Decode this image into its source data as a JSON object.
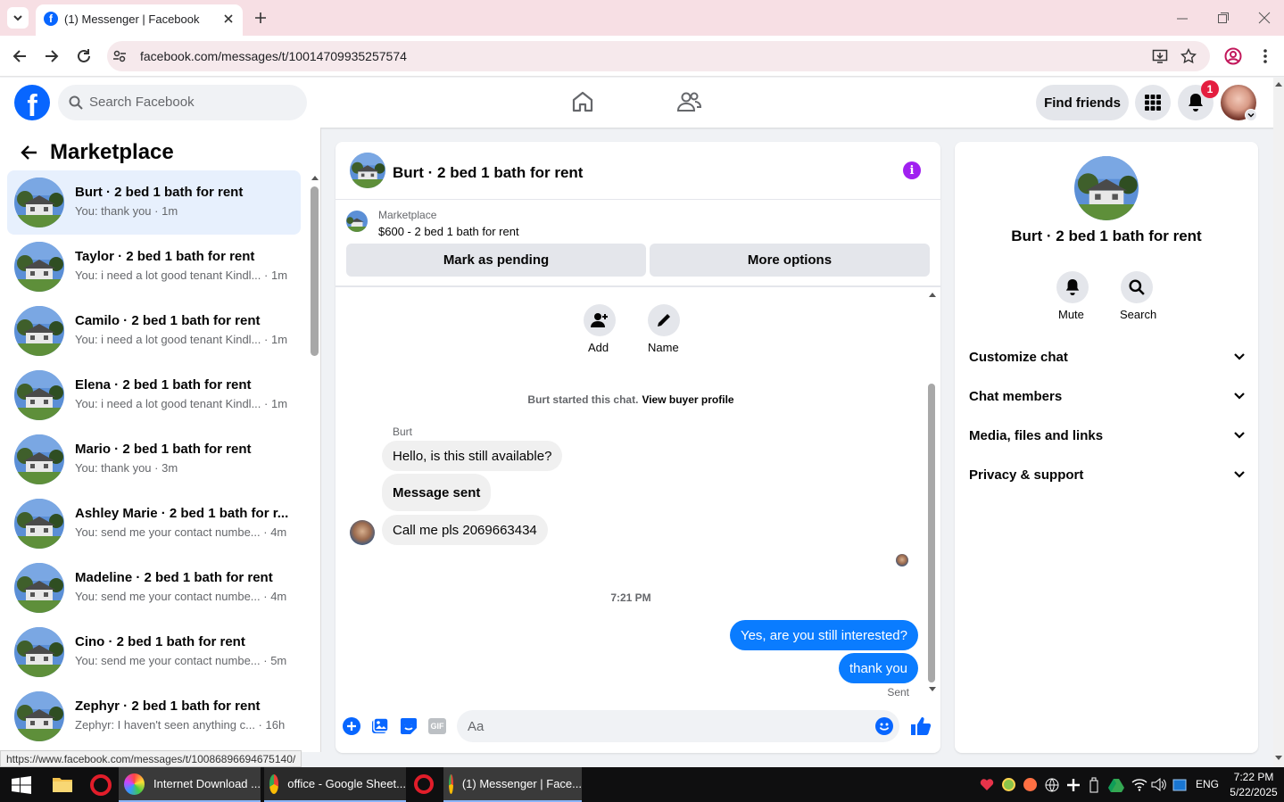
{
  "browser": {
    "tab_title": "(1) Messenger | Facebook",
    "url": "facebook.com/messages/t/10014709935257574",
    "status_url": "https://www.facebook.com/messages/t/10086896694675140/"
  },
  "fb_nav": {
    "search_placeholder": "Search Facebook",
    "find_friends_label": "Find friends",
    "notification_count": "1"
  },
  "sidebar": {
    "title": "Marketplace",
    "conversations": [
      {
        "title": "Burt · 2 bed 1 bath for rent",
        "snippet": "You: thank you · 1m",
        "active": true
      },
      {
        "title": "Taylor · 2 bed 1 bath for rent",
        "snippet": "You: i need a lot good tenant Kindl... · 1m"
      },
      {
        "title": "Camilo · 2 bed 1 bath for rent",
        "snippet": "You: i need a lot good tenant Kindl... · 1m"
      },
      {
        "title": "Elena · 2 bed 1 bath for rent",
        "snippet": "You: i need a lot good tenant Kindl... · 1m"
      },
      {
        "title": "Mario · 2 bed 1 bath for rent",
        "snippet": "You: thank you · 3m"
      },
      {
        "title": "Ashley Marie · 2 bed 1 bath for r...",
        "snippet": "You: send me your contact numbe... · 4m"
      },
      {
        "title": "Madeline · 2 bed 1 bath for rent",
        "snippet": "You: send me your contact numbe... · 4m"
      },
      {
        "title": "Cino · 2 bed 1 bath for rent",
        "snippet": "You: send me your contact numbe... · 5m"
      },
      {
        "title": "Zephyr · 2 bed 1 bath for rent",
        "snippet": "Zephyr: I haven't seen anything c... · 16h"
      }
    ]
  },
  "chat": {
    "header_title": "Burt · 2 bed 1 bath for rent",
    "listing_source": "Marketplace",
    "listing_title": "$600 - 2 bed 1 bath for rent",
    "mark_pending_label": "Mark as pending",
    "more_options_label": "More options",
    "add_label": "Add",
    "name_label": "Name",
    "started_text": "Burt started this chat.",
    "view_profile_label": "View buyer profile",
    "sender_name": "Burt",
    "incoming": [
      "Hello, is this still available?",
      "Message sent",
      "Call me pls 2069663434"
    ],
    "timestamp": "7:21 PM",
    "outgoing": [
      "Yes, are you still interested?",
      "thank you"
    ],
    "sent_label": "Sent",
    "composer_placeholder": "Aa"
  },
  "details": {
    "name": "Burt · 2 bed 1 bath for rent",
    "mute_label": "Mute",
    "search_label": "Search",
    "sections": [
      "Customize chat",
      "Chat members",
      "Media, files and links",
      "Privacy & support"
    ]
  },
  "taskbar": {
    "apps": [
      "Internet Download ...",
      "office - Google Sheet...",
      "(1) Messenger | Face..."
    ],
    "lang": "ENG",
    "time": "7:22 PM",
    "date": "5/22/2025"
  },
  "colors": {
    "fb_blue": "#0866ff",
    "bubble_blue": "#0a7cff",
    "active_row": "#e7f0fd",
    "info_purple": "#a020f0"
  }
}
